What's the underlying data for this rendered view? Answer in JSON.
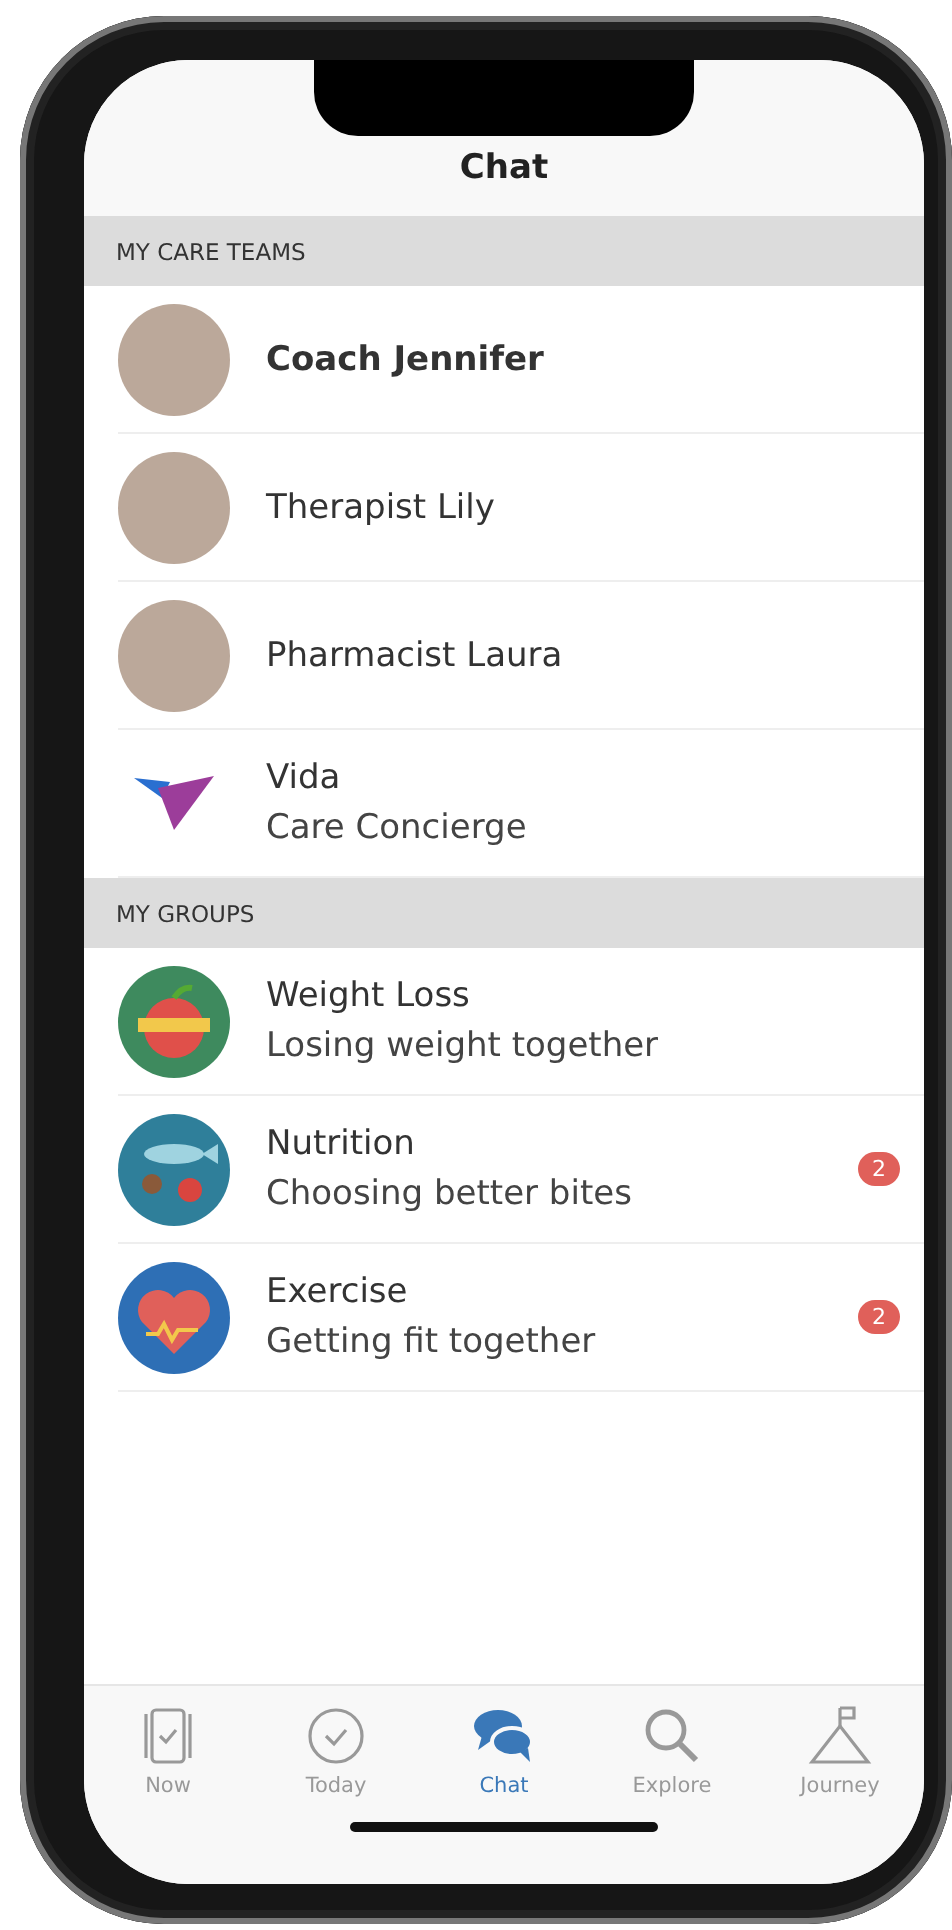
{
  "header": {
    "title": "Chat"
  },
  "sections": [
    {
      "title": "MY CARE TEAMS",
      "items": [
        {
          "kind": "avatar",
          "name": "Coach Jennifer",
          "unread": true
        },
        {
          "kind": "avatar",
          "name": "Therapist Lily",
          "unread": false
        },
        {
          "kind": "avatar",
          "name": "Pharmacist Laura",
          "unread": false
        },
        {
          "kind": "logo",
          "name": "Vida",
          "subtitle": "Care Concierge",
          "unread": false
        }
      ]
    },
    {
      "title": "MY GROUPS",
      "items": [
        {
          "kind": "apple",
          "name": "Weight Loss",
          "subtitle": "Losing weight together",
          "unread": false
        },
        {
          "kind": "fish",
          "name": "Nutrition",
          "subtitle": "Choosing better bites",
          "badge": "2",
          "unread": false
        },
        {
          "kind": "heart",
          "name": "Exercise",
          "subtitle": "Getting fit together",
          "badge": "2",
          "unread": false
        }
      ]
    }
  ],
  "tabs": [
    {
      "kind": "now",
      "label": "Now",
      "selected": false
    },
    {
      "kind": "today",
      "label": "Today",
      "selected": false
    },
    {
      "kind": "chat",
      "label": "Chat",
      "selected": true
    },
    {
      "kind": "explore",
      "label": "Explore",
      "selected": false
    },
    {
      "kind": "journey",
      "label": "Journey",
      "selected": false
    }
  ]
}
